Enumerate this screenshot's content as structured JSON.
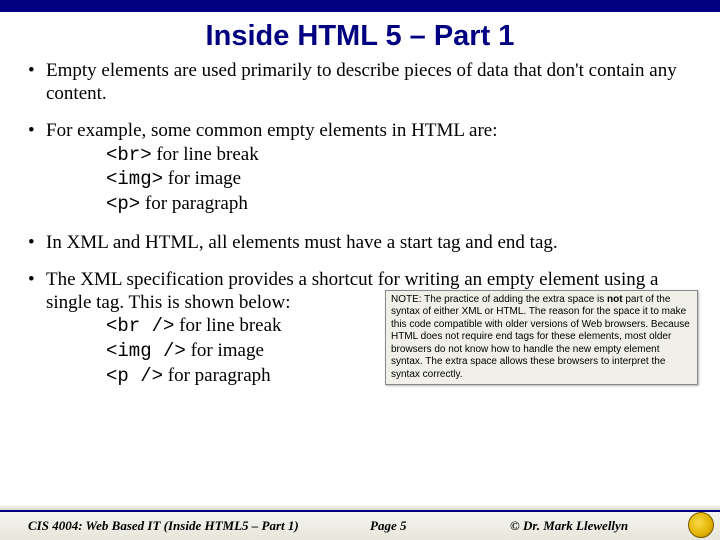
{
  "title": "Inside HTML 5 – Part 1",
  "bullets": {
    "b1": "Empty elements are used primarily to describe pieces of data that don't contain any content.",
    "b2": "For example, some common empty elements in HTML are:",
    "b2_items": {
      "i1_code": "<br>",
      "i1_text": " for line break",
      "i2_code": "<img>",
      "i2_text": " for image",
      "i3_code": "<p>",
      "i3_text": " for paragraph"
    },
    "b3": "In XML and HTML, all elements must have a start tag and end tag.",
    "b4": "The XML specification provides a shortcut for writing an empty element using a single tag.  This is shown below:",
    "b4_items": {
      "i1_code": "<br />",
      "i1_text": " for line break",
      "i2_code": "<img />",
      "i2_text": " for image",
      "i3_code": "<p />",
      "i3_text": " for paragraph"
    }
  },
  "note": {
    "prefix": "NOTE:  The practice of adding the extra space is ",
    "bold": "not",
    "rest": " part of the syntax of either XML or HTML.  The reason for the space it to make this code compatible with older versions of Web browsers.  Because HTML does not require end tags for these elements, most older browsers do not know how to handle the new empty element syntax.  The extra space allows these browsers to interpret the syntax correctly."
  },
  "footer": {
    "course": "CIS 4004: Web Based IT (Inside HTML5 – Part 1)",
    "page": "Page 5",
    "author": "© Dr. Mark Llewellyn"
  }
}
